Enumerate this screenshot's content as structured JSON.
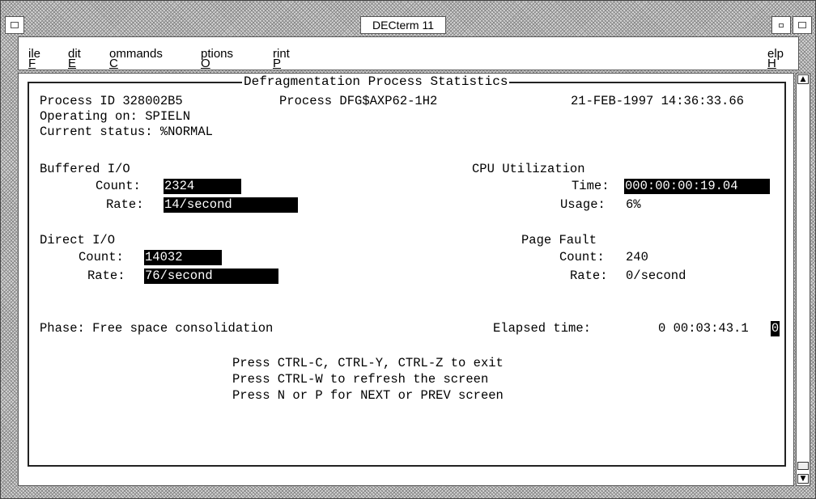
{
  "window": {
    "title": "DECterm 11"
  },
  "menu": {
    "file": "File",
    "edit": "Edit",
    "commands": "Commands",
    "options": "Options",
    "print": "Print",
    "help": "Help"
  },
  "screen": {
    "frame_title": "Defragmentation Process Statistics",
    "process_id": "Process ID 328002B5",
    "process_name": "Process DFG$AXP62-1H2",
    "datetime": "21-FEB-1997 14:36:33.66",
    "operating_on": "Operating on: SPIELN",
    "current_status": "Current status: %NORMAL",
    "buffered_io": {
      "heading": "Buffered I/O",
      "count_label": "Count:",
      "count_value": "2324",
      "rate_label": "Rate:",
      "rate_value": "14/second"
    },
    "cpu": {
      "heading": "CPU Utilization",
      "time_label": "Time:",
      "time_value": "000:00:00:19.04",
      "usage_label": "Usage:",
      "usage_value": "6%"
    },
    "direct_io": {
      "heading": "Direct I/O",
      "count_label": "Count:",
      "count_value": "14032",
      "rate_label": "Rate:",
      "rate_value": "76/second"
    },
    "page_fault": {
      "heading": "Page Fault",
      "count_label": "Count:",
      "count_value": "240",
      "rate_label": "Rate:",
      "rate_value": "0/second"
    },
    "phase": "Phase: Free space consolidation",
    "elapsed_label": "Elapsed time:",
    "elapsed_value": "0 00:03:43.1",
    "elapsed_cursor_char": "0",
    "instructions": [
      "Press CTRL-C, CTRL-Y, CTRL-Z to exit",
      "Press CTRL-W to refresh the screen",
      "Press N or P for NEXT or PREV screen"
    ]
  }
}
